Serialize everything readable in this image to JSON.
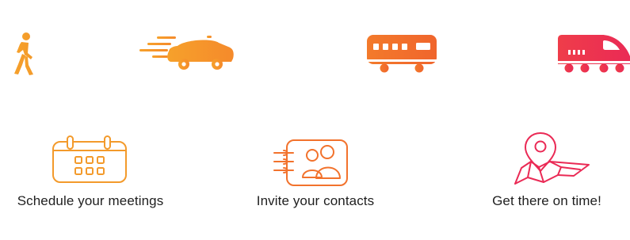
{
  "transport_icons": [
    {
      "name": "walking-person-icon"
    },
    {
      "name": "fast-car-icon"
    },
    {
      "name": "bus-icon"
    },
    {
      "name": "train-icon"
    }
  ],
  "features": [
    {
      "icon": "calendar-icon",
      "label": "Schedule your meetings"
    },
    {
      "icon": "contacts-card-icon",
      "label": "Invite your contacts"
    },
    {
      "icon": "map-pin-icon",
      "label": "Get there on time!"
    }
  ],
  "colors": {
    "gradient_start": "#f6a12b",
    "gradient_mid": "#f2682c",
    "gradient_end": "#ea2a55",
    "label_text": "#1f1f1f"
  }
}
